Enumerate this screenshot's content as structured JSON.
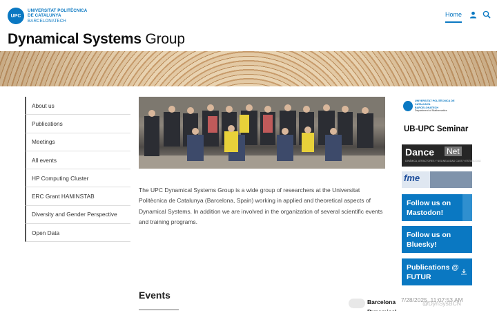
{
  "header": {
    "logo_seal": "UPC",
    "logo_line1": "UNIVERSITAT POLITÈCNICA",
    "logo_line2": "DE CATALUNYA",
    "logo_line3": "BARCELONATECH",
    "nav_home": "Home",
    "site_title_bold": "Dynamical Systems",
    "site_title_rest": " Group"
  },
  "sidebar": {
    "items": [
      {
        "label": "About us"
      },
      {
        "label": "Publications"
      },
      {
        "label": "Meetings"
      },
      {
        "label": "All events"
      },
      {
        "label": "HP Computing Cluster"
      },
      {
        "label": "ERC Grant HAMINSTAB"
      },
      {
        "label": "Diversity and Gender Perspective"
      },
      {
        "label": "Open Data"
      }
    ]
  },
  "main": {
    "intro": "The UPC Dynamical Systems Group is a wide group of researchers at the Universitat Politècnica de Catalunya (Barcelona, Spain) working in applied and theoretical aspects of Dynamical Systems. In addition we are involved in the organization of several scientific events and training programs.",
    "events_heading": "Events"
  },
  "right": {
    "dept_logo_line1": "UNIVERSITAT POLITÈCNICA DE CATALUNYA",
    "dept_logo_line2": "BARCELONATECH",
    "dept_logo_line3": "Department of Mathematics",
    "seminar": "UB-UPC Seminar",
    "dance_word": "Dance",
    "dance_net": "Net",
    "dance_sub": "DINÁMICA, ATRACTORES Y NOLINEALIDAD  CAOS Y ESTABILIDAD",
    "fme_label": "fme",
    "mastodon": "Follow us on Mastodon!",
    "bluesky": "Follow us on Bluesky!",
    "futur": "Publications @ FUTUR"
  },
  "footer": {
    "bcn_title": "Barcelona Dynamical",
    "timestamp": "7/28/2025, 11:07:53 AM",
    "handle": "@DynSysBCN"
  }
}
